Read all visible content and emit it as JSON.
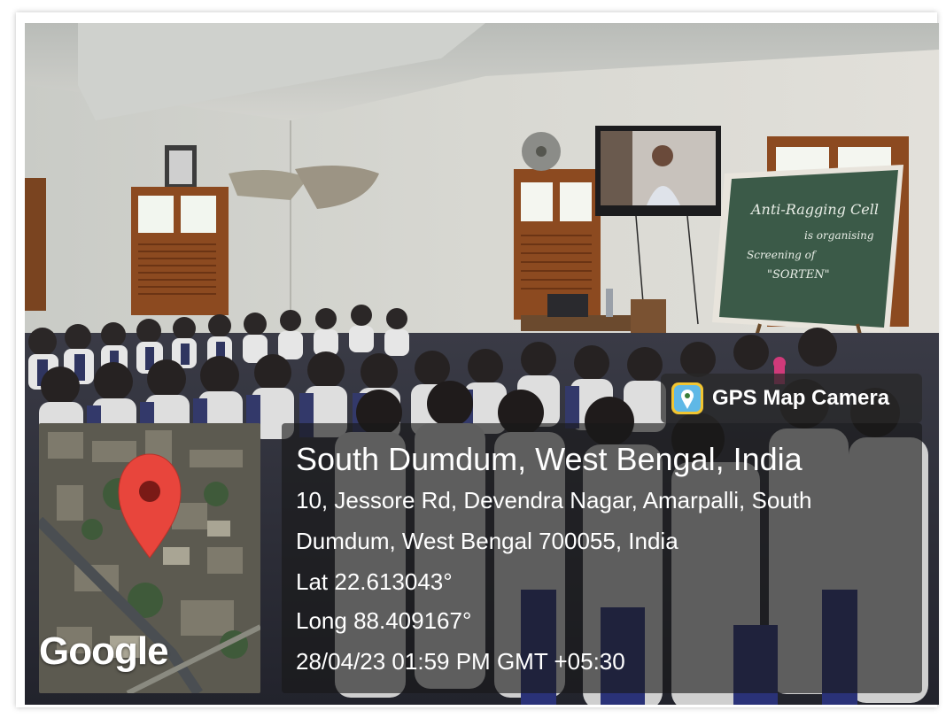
{
  "badge": {
    "label": "GPS Map Camera",
    "icon": "gps-map-camera-icon"
  },
  "location": {
    "title": "South Dumdum, West Bengal, India",
    "address_line1": "10, Jessore Rd, Devendra Nagar, Amarpalli, South",
    "address_line2": "Dumdum, West Bengal 700055, India",
    "latitude": "Lat 22.613043°",
    "longitude": "Long 88.409167°",
    "timestamp": "28/04/23 01:59 PM GMT +05:30"
  },
  "map": {
    "provider_label": "Google",
    "pin_icon": "location-pin-icon",
    "pin_color": "#e8453c"
  },
  "scene": {
    "board_text": [
      "Anti-Ragging Cell",
      "is organising",
      "Screening of",
      "\"SORTEN\""
    ]
  }
}
